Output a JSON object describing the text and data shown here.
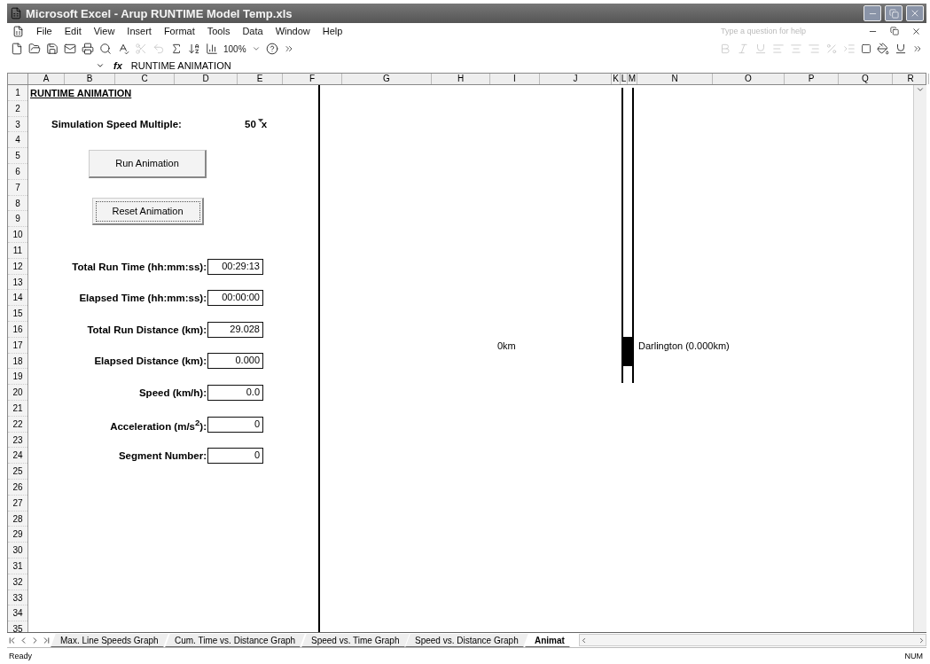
{
  "window": {
    "title": "Microsoft Excel - Arup RUNTIME Model Temp.xls"
  },
  "menu": [
    "File",
    "Edit",
    "View",
    "Insert",
    "Format",
    "Tools",
    "Data",
    "Window",
    "Help"
  ],
  "help_box": {
    "placeholder": "Type a question for help"
  },
  "toolbar": {
    "zoom": "100%"
  },
  "formula_bar": {
    "fx": "fx",
    "content": "RUNTIME ANIMATION"
  },
  "columns": [
    "A",
    "B",
    "C",
    "D",
    "E",
    "F",
    "G",
    "H",
    "I",
    "J",
    "K",
    "L",
    "M",
    "N",
    "O",
    "P",
    "Q",
    "R"
  ],
  "rows": [
    "1",
    "2",
    "3",
    "4",
    "5",
    "6",
    "7",
    "8",
    "9",
    "10",
    "11",
    "12",
    "13",
    "14",
    "15",
    "16",
    "17",
    "18",
    "19",
    "20",
    "21",
    "22",
    "23",
    "24",
    "25",
    "26",
    "27",
    "28",
    "29",
    "30",
    "31",
    "32",
    "33",
    "34",
    "35"
  ],
  "sheet": {
    "title": "RUNTIME ANIMATION",
    "speed_label": "Simulation Speed Multiple:",
    "speed_value": "50",
    "speed_unit": "x",
    "buttons": [
      {
        "label": "Run Animation",
        "focused": false
      },
      {
        "label": "Reset Animation",
        "focused": true
      }
    ],
    "fields": [
      {
        "label": "Total Run Time (hh:mm:ss):",
        "value": "00:29:13"
      },
      {
        "label": "Elapsed Time (hh:mm:ss):",
        "value": "00:00:00"
      },
      {
        "label": "Total Run Distance (km):",
        "value": "29.028"
      },
      {
        "label": "Elapsed Distance (km):",
        "value": "0.000"
      },
      {
        "label": "Speed (km/h):",
        "value": "0.0"
      },
      {
        "label": "Acceleration (m/s$^{2}$):",
        "value": "0"
      },
      {
        "label": "Segment Number:",
        "value": "0"
      }
    ]
  },
  "track": {
    "start_label": "0km",
    "station": "Darlington (0.000km)"
  },
  "sheet_tabs": [
    {
      "label": "Max. Line Speeds Graph",
      "selected": false
    },
    {
      "label": "Cum. Time vs. Distance Graph",
      "selected": false
    },
    {
      "label": "Speed vs. Time Graph",
      "selected": false
    },
    {
      "label": "Speed vs. Distance Graph",
      "selected": false
    },
    {
      "label": "Animat",
      "selected": true
    }
  ],
  "status_bar": {
    "left": "Ready",
    "right": "NUM"
  }
}
